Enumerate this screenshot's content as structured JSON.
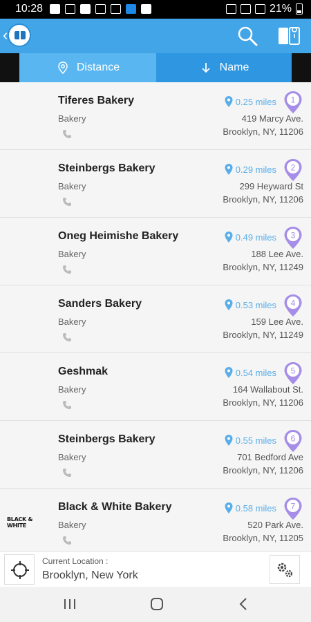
{
  "status": {
    "time": "10:28",
    "battery": "21%"
  },
  "sort": {
    "distance_label": "Distance",
    "name_label": "Name"
  },
  "accent": "#42a5e8",
  "items": [
    {
      "name": "Tiferes Bakery",
      "category": "Bakery",
      "distance": "0.25 miles",
      "rank": "1",
      "address1": "419 Marcy Ave.",
      "address2": "Brooklyn, NY, 11206"
    },
    {
      "name": "Steinbergs Bakery",
      "category": "Bakery",
      "distance": "0.29 miles",
      "rank": "2",
      "address1": "299 Heyward St",
      "address2": "Brooklyn, NY, 11206"
    },
    {
      "name": "Oneg Heimishe Bakery",
      "category": "Bakery",
      "distance": "0.49 miles",
      "rank": "3",
      "address1": "188 Lee Ave.",
      "address2": "Brooklyn, NY, 11249"
    },
    {
      "name": "Sanders Bakery",
      "category": "Bakery",
      "distance": "0.53 miles",
      "rank": "4",
      "address1": "159 Lee Ave.",
      "address2": "Brooklyn, NY, 11249"
    },
    {
      "name": "Geshmak",
      "category": "Bakery",
      "distance": "0.54 miles",
      "rank": "5",
      "address1": "164 Wallabout St.",
      "address2": "Brooklyn, NY, 11206"
    },
    {
      "name": "Steinbergs Bakery",
      "category": "Bakery",
      "distance": "0.55 miles",
      "rank": "6",
      "address1": "701 Bedford Ave",
      "address2": "Brooklyn, NY, 11206"
    },
    {
      "name": "Black & White Bakery",
      "category": "Bakery",
      "distance": "0.58 miles",
      "rank": "7",
      "address1": "520 Park Ave.",
      "address2": "Brooklyn, NY, 11205",
      "logo_text": "BLACK & WHITE"
    }
  ],
  "location": {
    "label": "Current Location :",
    "value": "Brooklyn, New York"
  }
}
